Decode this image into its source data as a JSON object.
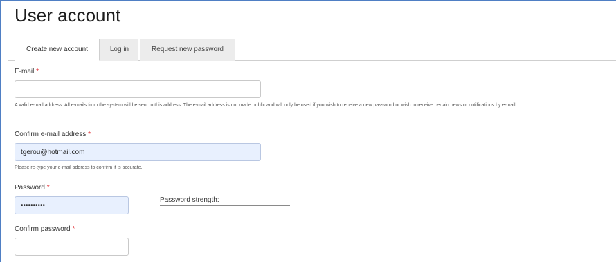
{
  "page": {
    "title": "User account"
  },
  "tabs": [
    {
      "label": "Create new account",
      "active": true
    },
    {
      "label": "Log in",
      "active": false
    },
    {
      "label": "Request new password",
      "active": false
    }
  ],
  "form": {
    "required_marker": "*",
    "email": {
      "label": "E-mail",
      "value": "",
      "description": "A valid e-mail address. All e-mails from the system will be sent to this address. The e-mail address is not made public and will only be used if you wish to receive a new password or wish to receive certain news or notifications by e-mail."
    },
    "confirm_email": {
      "label": "Confirm e-mail address",
      "value": "tgerou@hotmail.com",
      "description": "Please re-type your e-mail address to confirm it is accurate."
    },
    "password": {
      "label": "Password",
      "value": "••••••••••"
    },
    "password_strength": {
      "label": "Password strength:"
    },
    "confirm_password": {
      "label": "Confirm password",
      "value": ""
    }
  },
  "colors": {
    "required": "#e0242a",
    "autofill_background": "#e8f0fe",
    "frame_border": "#4f7fc4"
  }
}
